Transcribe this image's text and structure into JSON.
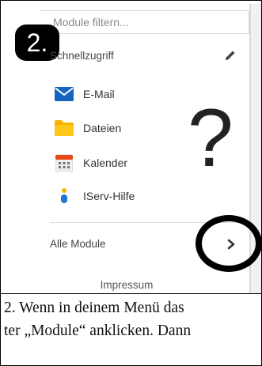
{
  "filter": {
    "placeholder": "Module filtern..."
  },
  "step_badge": "2.",
  "quick_access": {
    "label": "Schnellzugriff",
    "items": [
      {
        "label": "E-Mail",
        "icon": "mail-icon",
        "color": "#1565c0"
      },
      {
        "label": "Dateien",
        "icon": "folder-icon",
        "color": "#f7b500"
      },
      {
        "label": "Kalender",
        "icon": "calendar-icon",
        "color": "#e64a19"
      },
      {
        "label": "IServ-Hilfe",
        "icon": "help-icon",
        "color": "#1976d2"
      }
    ]
  },
  "all_modules": {
    "label": "Alle Module"
  },
  "annotation": {
    "question_mark": "?"
  },
  "footer": {
    "impressum": "Impressum"
  },
  "caption": {
    "line1": "2. Wenn in deinem Menü das",
    "line2": "ter „Module“ anklicken. Dann"
  }
}
